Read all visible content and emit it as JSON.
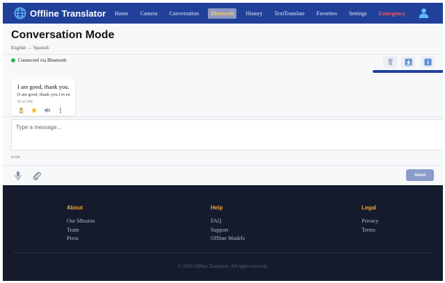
{
  "app": {
    "title": "Offline Translator",
    "icon": "globe-icon"
  },
  "nav": {
    "items": [
      {
        "label": "Home",
        "active": false
      },
      {
        "label": "Camera",
        "active": false
      },
      {
        "label": "Conversation",
        "active": false
      },
      {
        "label": "Bluetooth",
        "active": true
      },
      {
        "label": "History",
        "active": false
      },
      {
        "label": "TextTranslate",
        "active": false
      },
      {
        "label": "Favorites",
        "active": false
      },
      {
        "label": "Settings",
        "active": false
      },
      {
        "label": "Emergency",
        "active": false
      }
    ],
    "user_icon": "user-icon"
  },
  "header": {
    "title": "Conversation Mode",
    "language_pair": "English → Spanish"
  },
  "connection": {
    "status_text": "Connected via Bluetooth",
    "status_color": "#2bb55a"
  },
  "toolbar": {
    "icons": [
      "trash-icon",
      "download-icon",
      "info-icon"
    ]
  },
  "message": {
    "text": "I am good, thank you.",
    "translation": "[I am good, thank you.] in en",
    "time": "05:42 PM",
    "actions": [
      "copy-icon",
      "star-icon",
      "speaker-icon",
      "more-icon"
    ]
  },
  "composer": {
    "placeholder": "Type a message...",
    "value": "",
    "char_count": "0/500",
    "send_label": "Send"
  },
  "footer": {
    "columns": [
      {
        "title": "About",
        "links": [
          "Our Mission",
          "Team",
          "Press"
        ]
      },
      {
        "title": "Help",
        "links": [
          "FAQ",
          "Support",
          "Offline Models"
        ]
      },
      {
        "title": "Legal",
        "links": [
          "Privacy",
          "Terms"
        ]
      }
    ],
    "copyright": "© 2026 Offline Translator. All rights reserved."
  },
  "colors": {
    "nav_bg": "#21409a",
    "active_tab_text": "#f0c75e",
    "emergency": "#ff5757",
    "footer_bg": "#151b2c",
    "footer_heading": "#f0a830",
    "send_button": "#8b9ccb"
  }
}
